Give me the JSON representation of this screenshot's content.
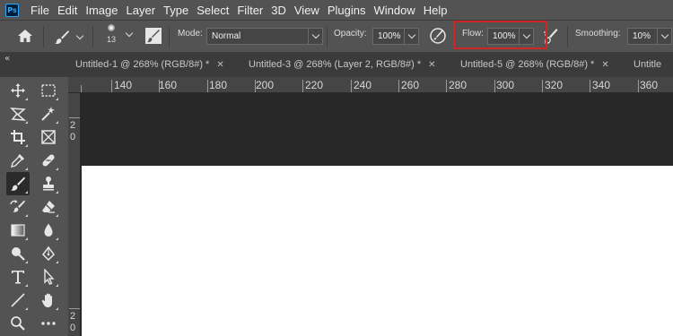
{
  "app": {
    "logo_text": "Ps"
  },
  "menu": [
    "File",
    "Edit",
    "Image",
    "Layer",
    "Type",
    "Select",
    "Filter",
    "3D",
    "View",
    "Plugins",
    "Window",
    "Help"
  ],
  "options": {
    "brush_size": "13",
    "mode_label": "Mode:",
    "mode_value": "Normal",
    "opacity_label": "Opacity:",
    "opacity_value": "100%",
    "flow_label": "Flow:",
    "flow_value": "100%",
    "smoothing_label": "Smoothing:",
    "smoothing_value": "10%"
  },
  "tabs": [
    {
      "title": "Untitled-1 @ 268% (RGB/8#) *"
    },
    {
      "title": "Untitled-3 @ 268% (Layer 2, RGB/8#) *"
    },
    {
      "title": "Untitled-5 @ 268% (RGB/8#) *"
    },
    {
      "title": "Untitle"
    }
  ],
  "ruler": {
    "top": [
      "140",
      "160",
      "180",
      "200",
      "220",
      "240",
      "260",
      "280",
      "300",
      "320",
      "340",
      "360"
    ],
    "left": [
      "2",
      "0",
      "2",
      "0"
    ]
  },
  "tools": [
    "move-tool-icon",
    "marquee-tool-icon",
    "lasso-tool-icon",
    "magic-wand-tool-icon",
    "crop-tool-icon",
    "frame-tool-icon",
    "eyedropper-tool-icon",
    "healing-brush-tool-icon",
    "brush-tool-icon",
    "clone-stamp-tool-icon",
    "history-brush-tool-icon",
    "eraser-tool-icon",
    "gradient-tool-icon",
    "blur-tool-icon",
    "dodge-tool-icon",
    "pen-tool-icon",
    "type-tool-icon",
    "path-selection-tool-icon",
    "line-tool-icon",
    "hand-tool-icon",
    "zoom-tool-icon",
    "more-tools-icon"
  ],
  "colors": {
    "highlight": "#d32424",
    "panel": "#535353",
    "workspace": "#282828",
    "canvas": "#ffffff"
  }
}
